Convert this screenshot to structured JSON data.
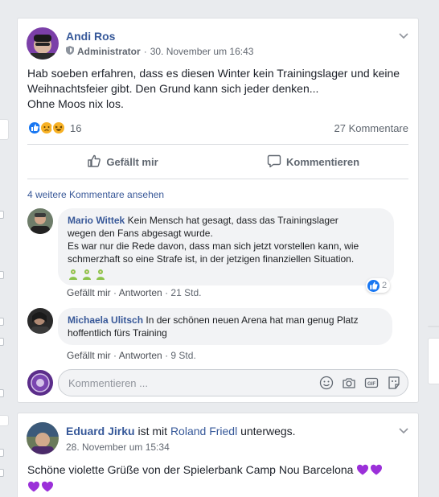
{
  "post1": {
    "author": "Andi Ros",
    "role": "Administrator",
    "separator": "·",
    "timestamp": "30. November um 16:43",
    "text_lines": [
      "Hab soeben erfahren, dass es diesen Winter kein Trainingslager und keine",
      "Weihnachtsfeier gibt. Den Grund kann sich jeder denken...",
      "Ohne Moos nix los."
    ],
    "reaction_count": "16",
    "comment_count": "27 Kommentare",
    "like_label": "Gefällt mir",
    "comment_label": "Kommentieren",
    "more_comments": "4 weitere Kommentare ansehen",
    "comments": [
      {
        "name": "Mario Wittek",
        "text_first": "Kein Mensch hat gesagt, dass das Trainingslager",
        "text_lines": [
          "wegen den Fans abgesagt wurde.",
          "Es war nur die Rede davon, dass man sich jetzt vorstellen kann, wie",
          "schmerzhaft so eine Strafe ist, in der jetzigen finanziellen Situation."
        ],
        "like": "Gefällt mir",
        "reply": "Antworten",
        "sep": "·",
        "time": "21 Std.",
        "likes": "2"
      },
      {
        "name": "Michaela Ulitsch",
        "text_first": "In der schönen neuen Arena hat man genug Platz",
        "text_lines": [
          "hoffentlich fürs Training"
        ],
        "like": "Gefällt mir",
        "reply": "Antworten",
        "sep": "·",
        "time": "9 Std."
      }
    ],
    "composer_placeholder": "Kommentieren ..."
  },
  "post2": {
    "author": "Eduard Jirku",
    "with_text": "ist mit",
    "tagged": "Roland Friedl",
    "with_suffix": "unterwegs.",
    "timestamp": "28. November um 15:34",
    "text": "Schöne violette Grüße von der Spielerbank Camp Nou Barcelona"
  },
  "colors": {
    "link": "#365899",
    "like_blue": "#1877f2",
    "page_bg": "#e9ebee",
    "heart_purple": "#9b30d9"
  },
  "icons": [
    "chevron-down-icon",
    "shield-icon",
    "like-reaction-icon",
    "sad-reaction-icon",
    "haha-reaction-icon",
    "thumb-up-icon",
    "speech-bubble-icon",
    "emoji-icon",
    "camera-icon",
    "gif-icon",
    "sticker-icon",
    "person-emoji-icon",
    "purple-heart-icon"
  ]
}
